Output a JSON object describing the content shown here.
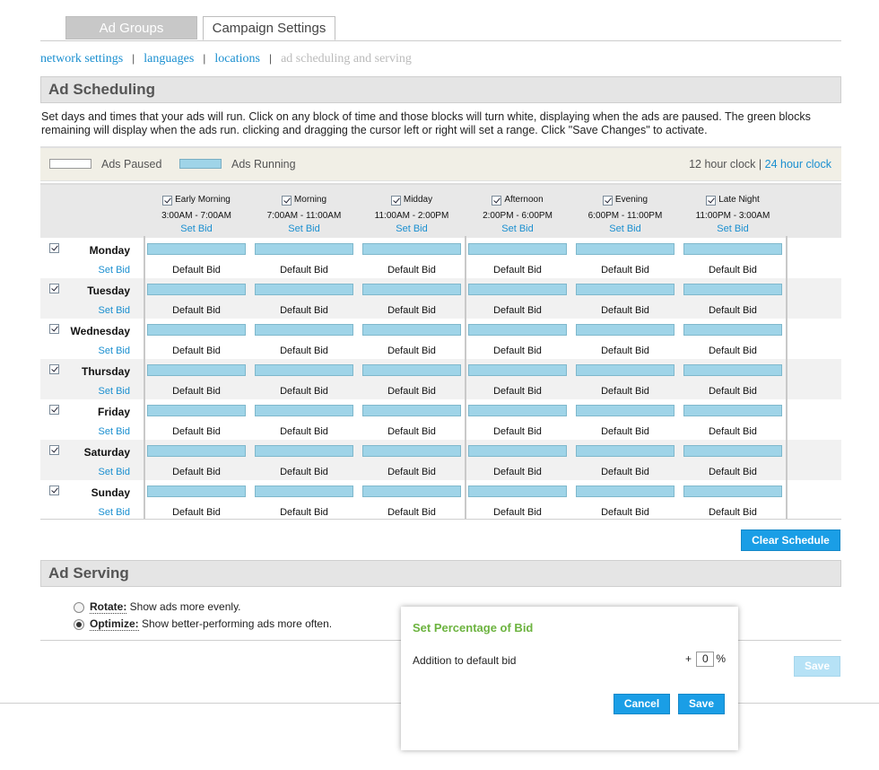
{
  "tabs": [
    {
      "label": "Ad Groups",
      "active": false
    },
    {
      "label": "Campaign Settings",
      "active": true
    }
  ],
  "subnav": {
    "items": [
      "network settings",
      "languages",
      "locations"
    ],
    "current": "ad scheduling and serving",
    "separator": "|"
  },
  "scheduling": {
    "title": "Ad Scheduling",
    "description": "Set days and times that your ads will run. Click on any block of time and those blocks will turn white, displaying when the ads are paused. The green blocks remaining will display when the ads run. clicking and dragging the cursor left or right will set a range. Click \"Save Changes\" to activate.",
    "legend": {
      "paused": "Ads Paused",
      "running": "Ads Running",
      "clock12": "12 hour clock",
      "clock_sep": "|",
      "clock24": "24 hour clock"
    },
    "periods": [
      {
        "name": "Early Morning",
        "time": "3:00AM - 7:00AM",
        "set_bid": "Set Bid",
        "checked": true
      },
      {
        "name": "Morning",
        "time": "7:00AM - 11:00AM",
        "set_bid": "Set Bid",
        "checked": true
      },
      {
        "name": "Midday",
        "time": "11:00AM - 2:00PM",
        "set_bid": "Set Bid",
        "checked": true
      },
      {
        "name": "Afternoon",
        "time": "2:00PM - 6:00PM",
        "set_bid": "Set Bid",
        "checked": true
      },
      {
        "name": "Evening",
        "time": "6:00PM - 11:00PM",
        "set_bid": "Set Bid",
        "checked": true
      },
      {
        "name": "Late Night",
        "time": "11:00PM - 3:00AM",
        "set_bid": "Set Bid",
        "checked": true
      }
    ],
    "days": [
      {
        "name": "Monday",
        "set_bid": "Set Bid",
        "checked": true
      },
      {
        "name": "Tuesday",
        "set_bid": "Set Bid",
        "checked": true
      },
      {
        "name": "Wednesday",
        "set_bid": "Set Bid",
        "checked": true
      },
      {
        "name": "Thursday",
        "set_bid": "Set Bid",
        "checked": true
      },
      {
        "name": "Friday",
        "set_bid": "Set Bid",
        "checked": true
      },
      {
        "name": "Saturday",
        "set_bid": "Set Bid",
        "checked": true
      },
      {
        "name": "Sunday",
        "set_bid": "Set Bid",
        "checked": true
      }
    ],
    "slot_bid_label": "Default Bid",
    "clear_button": "Clear Schedule"
  },
  "serving": {
    "title": "Ad Serving",
    "options": [
      {
        "label": "Rotate:",
        "text": " Show ads more evenly.",
        "selected": false
      },
      {
        "label": "Optimize:",
        "text": " Show better-performing ads more often.",
        "selected": true
      }
    ],
    "save_button": "Save"
  },
  "modal": {
    "title": "Set Percentage of Bid",
    "label": "Addition to default bid",
    "prefix": "+",
    "value": "0",
    "suffix": "%",
    "cancel": "Cancel",
    "save": "Save"
  },
  "colors": {
    "running": "#9fd4e8",
    "accent_button": "#1a9ee6",
    "modal_title": "#6cb33f",
    "link": "#1a8fd0"
  }
}
